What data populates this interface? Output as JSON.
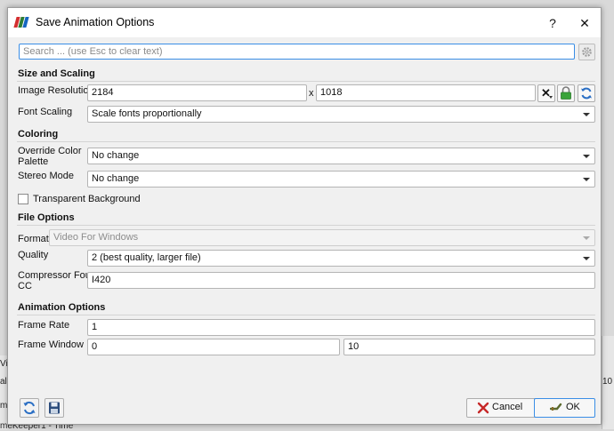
{
  "background": {
    "left_text_1": "Vi",
    "left_text_2": "al",
    "left_text_3": "m",
    "bottom_text": "meKeeper1 - Time",
    "right_text": "10"
  },
  "dialog": {
    "title": "Save Animation Options",
    "help_glyph": "?",
    "close_glyph": "✕"
  },
  "search": {
    "placeholder": "Search ... (use Esc to clear text)",
    "value": ""
  },
  "size_scaling": {
    "title": "Size and Scaling",
    "image_resolution_label": "Image Resolution",
    "width": "2184",
    "times": "x",
    "height": "1018",
    "font_scaling_label": "Font Scaling",
    "font_scaling_value": "Scale fonts proportionally"
  },
  "coloring": {
    "title": "Coloring",
    "override_label_1": "Override Color",
    "override_label_2": "Palette",
    "override_value": "No change",
    "stereo_label": "Stereo Mode",
    "stereo_value": "No change",
    "transparent_label": "Transparent Background"
  },
  "file_options": {
    "title": "File Options",
    "format_label": "Format",
    "format_value": "Video For Windows",
    "quality_label": "Quality",
    "quality_value": "2 (best quality, larger file)",
    "compressor_label_1": "Compressor Four",
    "compressor_label_2": "CC",
    "compressor_value": "I420"
  },
  "animation_options": {
    "title": "Animation Options",
    "frame_rate_label": "Frame Rate",
    "frame_rate_value": "1",
    "frame_window_label": "Frame Window",
    "frame_window_start": "0",
    "frame_window_end": "10"
  },
  "buttons": {
    "cancel_label": "Cancel",
    "ok_label": "OK"
  },
  "colors": {
    "accent": "#3a8ee6",
    "lock_green": "#3aa33a",
    "cancel_red": "#c62828",
    "logo_red": "#d32f2f",
    "logo_green": "#2e7d32",
    "logo_blue": "#1565c0"
  }
}
